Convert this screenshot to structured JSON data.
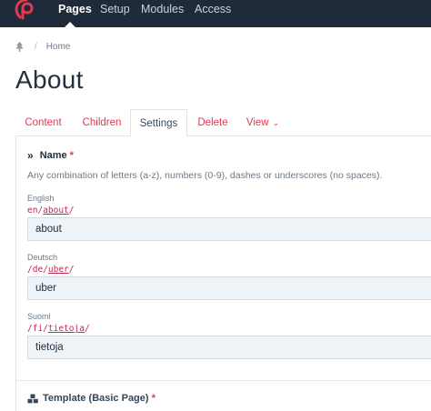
{
  "nav": {
    "items": [
      {
        "label": "Pages",
        "active": true
      },
      {
        "label": "Setup",
        "active": false
      },
      {
        "label": "Modules",
        "active": false
      },
      {
        "label": "Access",
        "active": false
      }
    ]
  },
  "breadcrumb": {
    "separator": "/",
    "home": "Home"
  },
  "page": {
    "title": "About"
  },
  "tabs": [
    {
      "label": "Content"
    },
    {
      "label": "Children"
    },
    {
      "label": "Settings"
    },
    {
      "label": "Delete"
    },
    {
      "label": "View"
    }
  ],
  "name_field": {
    "label": "Name",
    "required_mark": "*",
    "description": "Any combination of letters (a-z), numbers (0-9), dashes or underscores (no spaces).",
    "languages": [
      {
        "label": "English",
        "prefix": "en/",
        "slug": "about",
        "suffix": "/",
        "value": "about"
      },
      {
        "label": "Deutsch",
        "prefix": "/de/",
        "slug": "uber",
        "suffix": "/",
        "value": "uber"
      },
      {
        "label": "Suomi",
        "prefix": "/fi/",
        "slug": "tietoja",
        "suffix": "/",
        "value": "tietoja"
      }
    ]
  },
  "template_field": {
    "label": "Template (Basic Page)",
    "required_mark": "*"
  },
  "colors": {
    "nav_bg": "#1f2b3a",
    "accent": "#e4384f",
    "input_bg": "#eef3f8"
  }
}
